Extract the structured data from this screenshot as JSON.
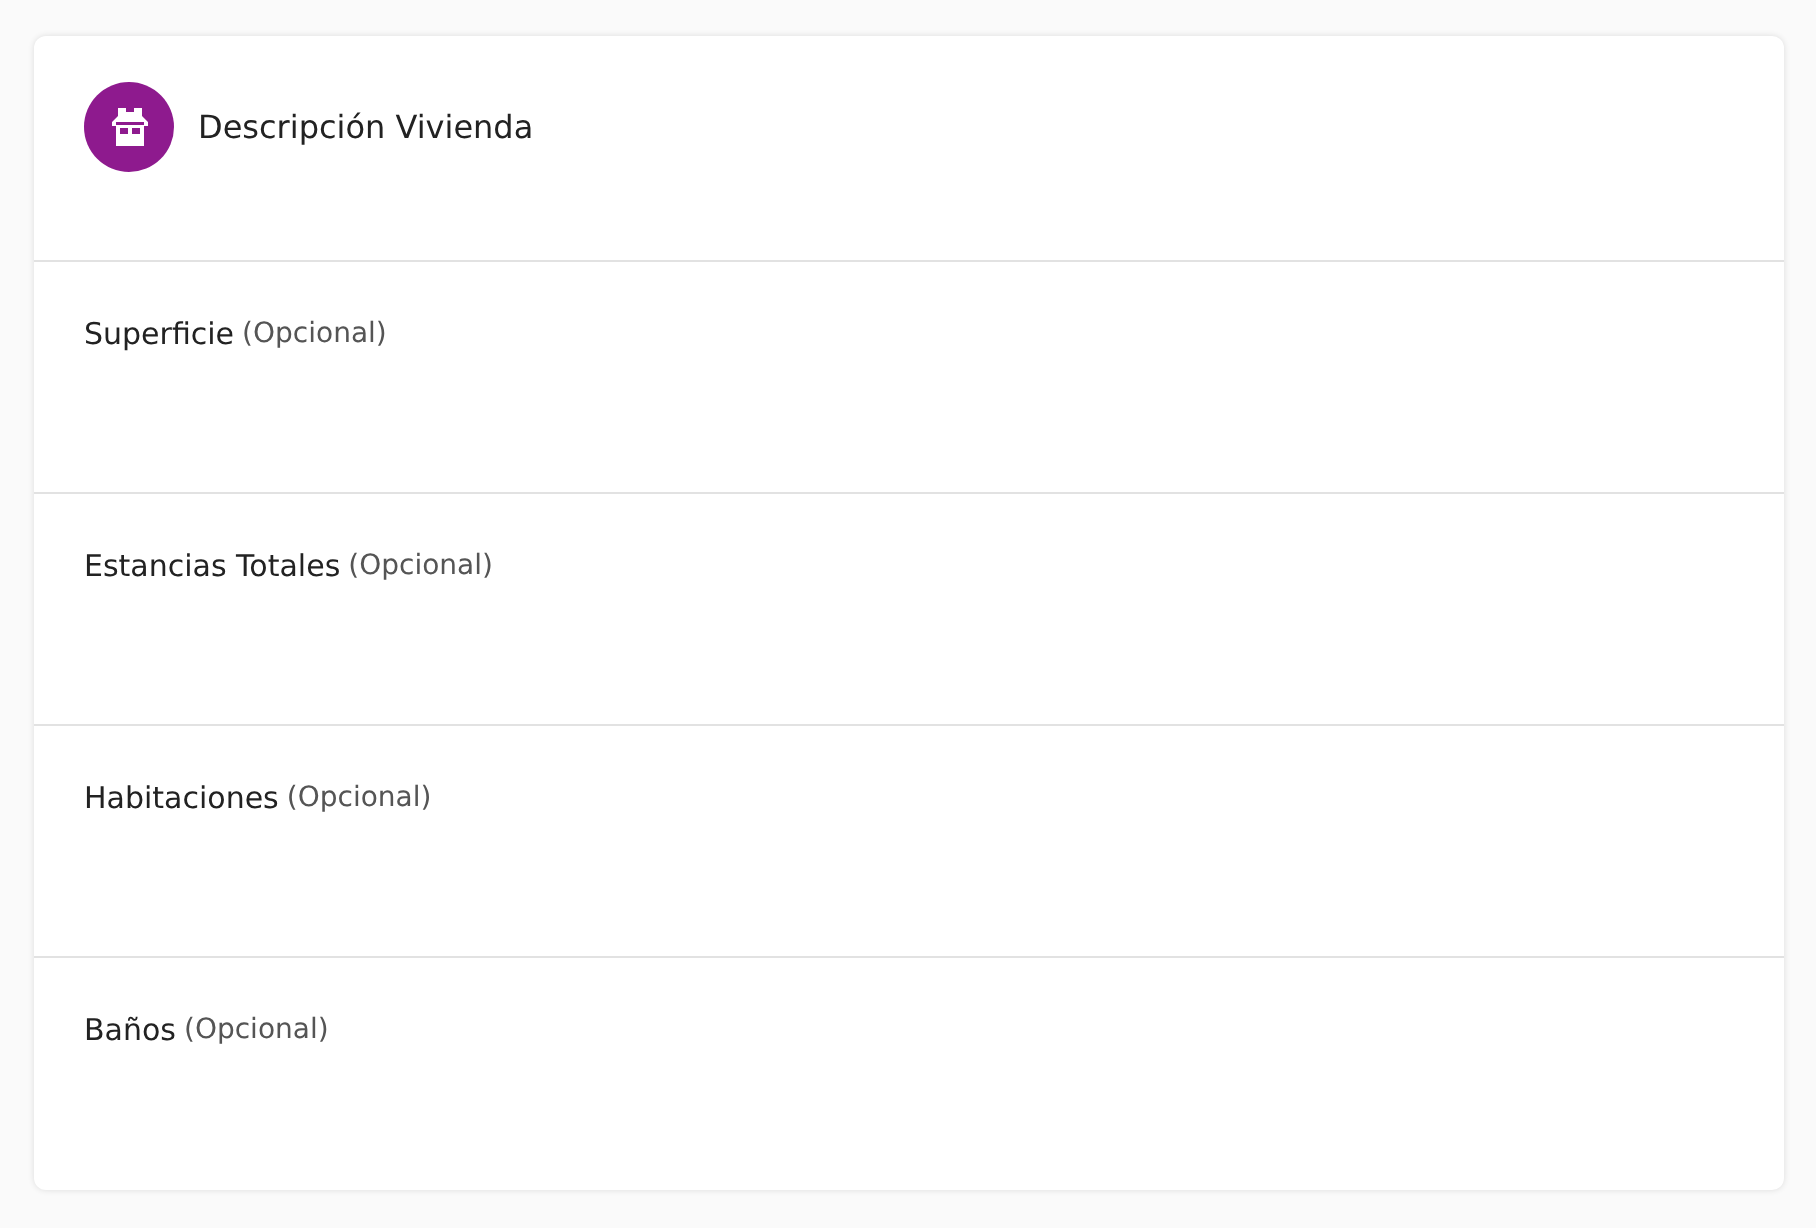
{
  "header": {
    "title": "Descripción Vivienda"
  },
  "fields": [
    {
      "label": "Superficie",
      "hint": "(Opcional)"
    },
    {
      "label": "Estancias Totales",
      "hint": "(Opcional)"
    },
    {
      "label": "Habitaciones",
      "hint": "(Opcional)"
    },
    {
      "label": "Baños",
      "hint": "(Opcional)"
    }
  ]
}
